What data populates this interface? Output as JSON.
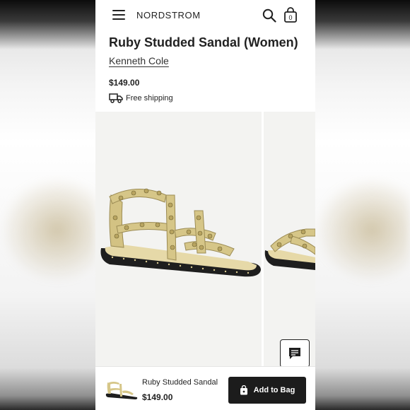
{
  "header": {
    "brand": "NORDSTROM",
    "bag_count": "0",
    "icons": [
      "menu-icon",
      "search-icon",
      "shopping-bag-icon"
    ]
  },
  "product": {
    "title": "Ruby Studded Sandal (Women)",
    "brand": "Kenneth Cole",
    "price": "$149.00",
    "shipping": "Free shipping"
  },
  "sticky_bar": {
    "name": "Ruby Studded Sandal",
    "price": "$149.00",
    "button_label": "Add to Bag"
  },
  "colors": {
    "text": "#222222",
    "button_bg": "#1c1c1c",
    "sandal_gold": "#d8c98e",
    "sole": "#1e1e1e"
  }
}
